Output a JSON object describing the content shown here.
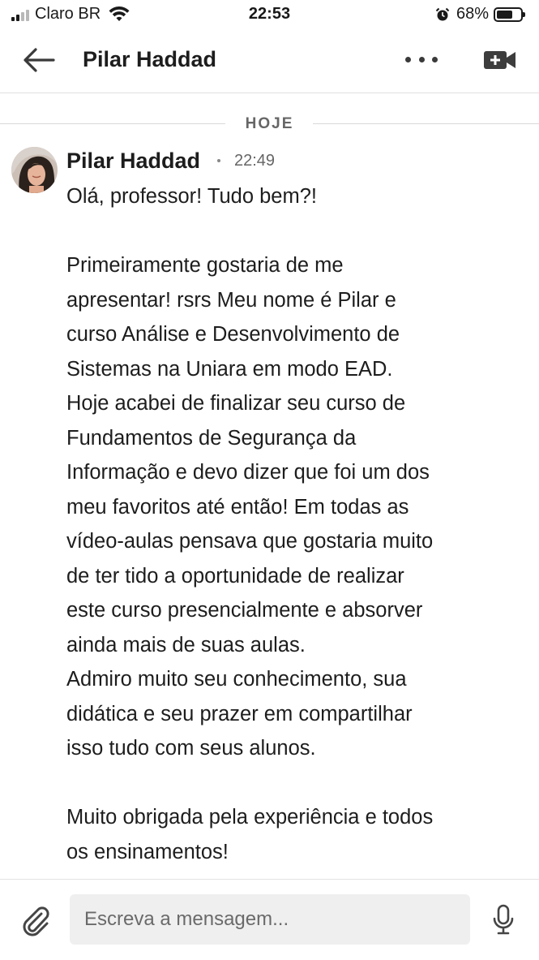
{
  "status_bar": {
    "carrier": "Claro BR",
    "time": "22:53",
    "battery_percent_label": "68%",
    "battery_level": 0.68,
    "icons": [
      "signal-icon",
      "wifi-icon",
      "alarm-icon",
      "battery-icon"
    ]
  },
  "header": {
    "title": "Pilar Haddad",
    "icons": [
      "back-arrow-icon",
      "more-dots-icon",
      "video-call-icon"
    ]
  },
  "date_divider": "HOJE",
  "message": {
    "sender": "Pilar Haddad",
    "time": "22:49",
    "lines": [
      "Olá, professor! Tudo bem?!",
      "",
      "Primeiramente gostaria de me",
      "apresentar! rsrs Meu nome é Pilar e",
      "curso Análise e Desenvolvimento de",
      "Sistemas na Uniara em modo EAD.",
      "Hoje acabei de finalizar seu curso de",
      "Fundamentos de Segurança da",
      "Informação e devo dizer que foi um dos",
      "meu favoritos até então! Em todas as",
      "vídeo-aulas pensava que gostaria muito",
      "de ter tido a oportunidade de realizar",
      "este curso presencialmente e absorver",
      "ainda mais de suas aulas.",
      "Admiro muito seu conhecimento, sua",
      "didática e seu prazer em compartilhar",
      "isso tudo com seus alunos.",
      "",
      "Muito obrigada pela experiência e todos",
      "os ensinamentos!"
    ]
  },
  "composer": {
    "placeholder": "Escreva a mensagem...",
    "value": "",
    "icons": [
      "paperclip-icon",
      "microphone-icon"
    ]
  },
  "colors": {
    "text": "#1d1d1d",
    "muted": "#666666",
    "input_bg": "#efefef",
    "divider": "#d9d9d9"
  }
}
